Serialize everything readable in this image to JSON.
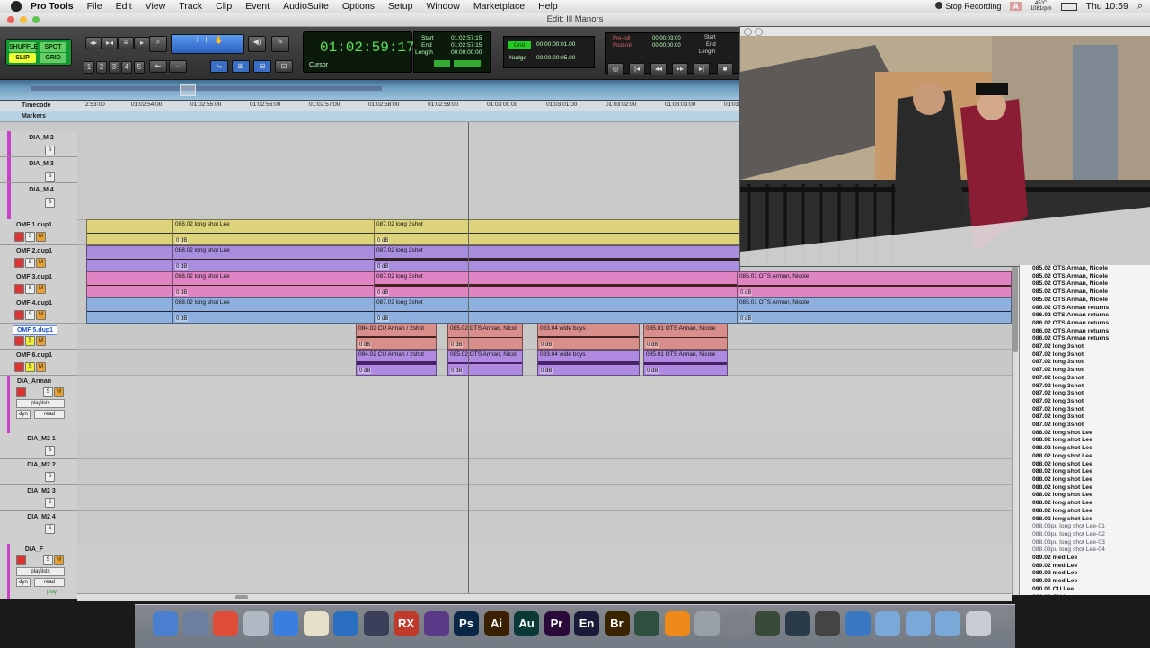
{
  "menubar": {
    "app": "Pro Tools",
    "items": [
      "File",
      "Edit",
      "View",
      "Track",
      "Clip",
      "Event",
      "AudioSuite",
      "Options",
      "Setup",
      "Window",
      "Marketplace",
      "Help"
    ],
    "stop_recording": "Stop Recording",
    "adobe": "A",
    "temp": "45°C",
    "resolution": "1081rpm",
    "clock": "Thu 10:59"
  },
  "window": {
    "title": "Edit: Ill Manors"
  },
  "toolbar": {
    "shuffle": "SHUFFLE",
    "spot": "SPOT",
    "slip": "SLIP",
    "grid": "GRID",
    "zoom_presets": [
      "1",
      "2",
      "3",
      "4",
      "5"
    ],
    "main_counter": "01:02:59:17",
    "cursor_label": "Cursor",
    "start_label": "Start",
    "end_label": "End",
    "length_label": "Length",
    "start": "01:02:57:15",
    "end": "01:02:57:15",
    "length": "00:00:00:00",
    "grid_label": "Grid",
    "grid_value": "00:00:00:01.00",
    "nudge_label": "Nudge",
    "nudge_value": "00:00:00:05.00",
    "preroll_label": "Pre-roll",
    "postroll_label": "Post-roll",
    "preroll": "00:00:03:00",
    "postroll": "00:00:00:00",
    "t_start": "Start",
    "t_end": "End",
    "t_length": "Length"
  },
  "rulers": {
    "timecode_label": "Timecode",
    "markers_label": "Markers",
    "ticks": [
      "2:53:00",
      "01:02:54:00",
      "01:02:55:00",
      "01:02:56:00",
      "01:02:57:00",
      "01:02:58:00",
      "01:02:59:00",
      "01:03:00:00",
      "01:03:01:00",
      "01:03:02:00",
      "01:03:03:00",
      "01:03:"
    ]
  },
  "tracks": [
    {
      "name": "DIA_M 2",
      "type": "small"
    },
    {
      "name": "DIA_M 3",
      "type": "small"
    },
    {
      "name": "DIA_M 4",
      "type": "small"
    },
    {
      "name": "OMF 1.dup1",
      "type": "audio"
    },
    {
      "name": "OMF 2.dup1",
      "type": "audio"
    },
    {
      "name": "OMF 3.dup1",
      "type": "audio"
    },
    {
      "name": "OMF 4.dup1",
      "type": "audio"
    },
    {
      "name": "OMF 5.dup1",
      "type": "audio",
      "selected": true
    },
    {
      "name": "OMF 6.dup1",
      "type": "audio"
    },
    {
      "name": "DIA_Arman",
      "type": "big"
    },
    {
      "name": "DIA_M2 1",
      "type": "small"
    },
    {
      "name": "DIA_M2 2",
      "type": "small"
    },
    {
      "name": "DIA_M2 3",
      "type": "small"
    },
    {
      "name": "DIA_M2 4",
      "type": "small"
    },
    {
      "name": "DIA_F",
      "type": "big"
    }
  ],
  "track_controls": {
    "playlists": "playlists",
    "dyn": "dyn",
    "read": "read",
    "play": "play",
    "solo": "S",
    "mute": "M"
  },
  "clips": {
    "long_shot": "088.02 long shot Lee",
    "three_shot": "087.02 long 3shot",
    "ots_nicole": "085.01 OTS Arman, Nicole",
    "cu_2shot": "084.02 CU Arman / 2shot",
    "ots_nicol": "085.02 OTS Arman, Nicol",
    "wide_boys": "083.04 wide boys",
    "db": "0 dB"
  },
  "region_list": [
    {
      "t": "085.02 OTS Arman, Nicole"
    },
    {
      "t": "085.02 OTS Arman, Nicole"
    },
    {
      "t": "085.02 OTS Arman, Nicole"
    },
    {
      "t": "085.02 OTS Arman, Nicole"
    },
    {
      "t": "085.02 OTS Arman, Nicole"
    },
    {
      "t": "086.02 OTS Arman returns"
    },
    {
      "t": "086.02 OTS Arman returns"
    },
    {
      "t": "086.02 OTS Arman returns"
    },
    {
      "t": "086.02 OTS Arman returns"
    },
    {
      "t": "086.02 OTS Arman returns"
    },
    {
      "t": "087.02 long 3shot"
    },
    {
      "t": "087.02 long 3shot"
    },
    {
      "t": "087.02 long 3shot"
    },
    {
      "t": "087.02 long 3shot"
    },
    {
      "t": "087.02 long 3shot"
    },
    {
      "t": "087.02 long 3shot"
    },
    {
      "t": "087.02 long 3shot"
    },
    {
      "t": "087.02 long 3shot"
    },
    {
      "t": "087.02 long 3shot"
    },
    {
      "t": "087.02 long 3shot"
    },
    {
      "t": "087.02 long 3shot"
    },
    {
      "t": "088.02 long shot Lee"
    },
    {
      "t": "088.02 long shot Lee"
    },
    {
      "t": "088.02 long shot Lee"
    },
    {
      "t": "088.02 long shot Lee"
    },
    {
      "t": "088.02 long shot Lee"
    },
    {
      "t": "088.02 long shot Lee"
    },
    {
      "t": "088.02 long shot Lee"
    },
    {
      "t": "088.02 long shot Lee"
    },
    {
      "t": "088.02 long shot Lee"
    },
    {
      "t": "088.02 long shot Lee"
    },
    {
      "t": "088.02 long shot Lee"
    },
    {
      "t": "088.02 long shot Lee"
    },
    {
      "t": "088.03pu long shot Lee-01",
      "dim": true
    },
    {
      "t": "088.03pu long shot Lee-02",
      "dim": true
    },
    {
      "t": "088.03pu long shot Lee-03",
      "dim": true
    },
    {
      "t": "088.03pu long shot Lee-04",
      "dim": true
    },
    {
      "t": "089.02 med Lee"
    },
    {
      "t": "089.02 med Lee"
    },
    {
      "t": "089.02 med Lee"
    },
    {
      "t": "089.02 med Lee"
    },
    {
      "t": "090.01 CU Lee"
    },
    {
      "t": "090.01 CU Lee"
    }
  ],
  "dock": [
    {
      "label": "",
      "color": "#4a7fd0",
      "name": "finder-icon"
    },
    {
      "label": "",
      "color": "#6c7fa0",
      "name": "launchpad-icon"
    },
    {
      "label": "",
      "color": "#e04b3a",
      "name": "chrome-icon"
    },
    {
      "label": "",
      "color": "#b0b8c4",
      "name": "preview-icon"
    },
    {
      "label": "",
      "color": "#3a7fe0",
      "name": "itunes-icon"
    },
    {
      "label": "",
      "color": "#e6e0c8",
      "name": "script-icon"
    },
    {
      "label": "",
      "color": "#2a6fbf",
      "name": "globe-icon"
    },
    {
      "label": "",
      "color": "#3a3f5a",
      "name": "avid-icon"
    },
    {
      "label": "RX",
      "color": "#c0392b",
      "name": "rx-icon"
    },
    {
      "label": "",
      "color": "#5b3a8a",
      "name": "slate-icon"
    },
    {
      "label": "Ps",
      "color": "#0b2748",
      "name": "photoshop-icon"
    },
    {
      "label": "Ai",
      "color": "#3a2000",
      "name": "illustrator-icon"
    },
    {
      "label": "Au",
      "color": "#0a3a38",
      "name": "audition-icon"
    },
    {
      "label": "Pr",
      "color": "#2a0a3a",
      "name": "premiere-icon"
    },
    {
      "label": "En",
      "color": "#1a1a3a",
      "name": "encoder-icon"
    },
    {
      "label": "Br",
      "color": "#3a2400",
      "name": "bridge-icon"
    },
    {
      "label": "",
      "color": "#2f4f3f",
      "name": "activity-monitor-icon"
    },
    {
      "label": "",
      "color": "#ef8a1a",
      "name": "vlc-icon"
    },
    {
      "label": "",
      "color": "#9aa0a8",
      "name": "automator-icon"
    },
    {
      "label": "",
      "color": "#7a7f88",
      "name": "settings-icon"
    },
    {
      "label": "",
      "color": "#3a4a3a",
      "name": "utility-icon"
    },
    {
      "label": "",
      "color": "#2a3a4a",
      "name": "media-icon"
    },
    {
      "label": "",
      "color": "#444",
      "name": "tool-icon"
    },
    {
      "label": "",
      "color": "#3a78c4",
      "name": "browser-icon"
    },
    {
      "label": "",
      "color": "#7aa8d8",
      "name": "folder-apps-icon"
    },
    {
      "label": "",
      "color": "#7aa8d8",
      "name": "folder-docs-icon"
    },
    {
      "label": "",
      "color": "#7aa8d8",
      "name": "folder-downloads-icon"
    },
    {
      "label": "",
      "color": "#c8ccd2",
      "name": "trash-icon"
    }
  ]
}
